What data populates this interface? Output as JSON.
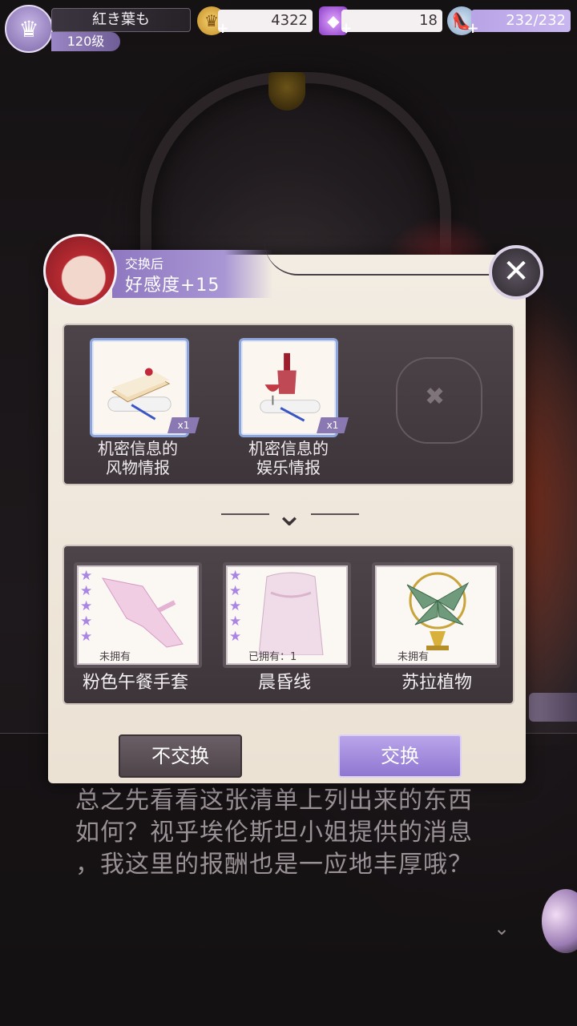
{
  "hud": {
    "player_name": "紅き葉も",
    "player_level": "120级",
    "gold": "4322",
    "gems": "18",
    "stamina": "232/232"
  },
  "exchange": {
    "affection_label": "交换后",
    "affection_value": "好感度+15",
    "input_items": [
      {
        "name": "机密信息的\n风物情报",
        "qty": "x1",
        "icon": "cake-scroll-icon"
      },
      {
        "name": "机密信息的\n娱乐情报",
        "qty": "x1",
        "icon": "wine-scroll-icon"
      }
    ],
    "rewards": [
      {
        "name": "粉色午餐手套",
        "owned": "未拥有",
        "stars": 5
      },
      {
        "name": "晨昏线",
        "owned": "已拥有：1",
        "stars": 5
      },
      {
        "name": "苏拉植物",
        "owned": "未拥有",
        "stars": 0
      }
    ],
    "decline_label": "不交换",
    "accept_label": "交换"
  },
  "dialogue": {
    "line1": "总之先看看这张清单上列出来的东西",
    "line2": "如何？视乎埃伦斯坦小姐提供的消息",
    "line3": "，我这里的报酬也是一应地丰厚哦？"
  },
  "colors": {
    "accent": "#8f76d1",
    "panel": "#f3ece2",
    "slot_bg": "#3d3539"
  }
}
